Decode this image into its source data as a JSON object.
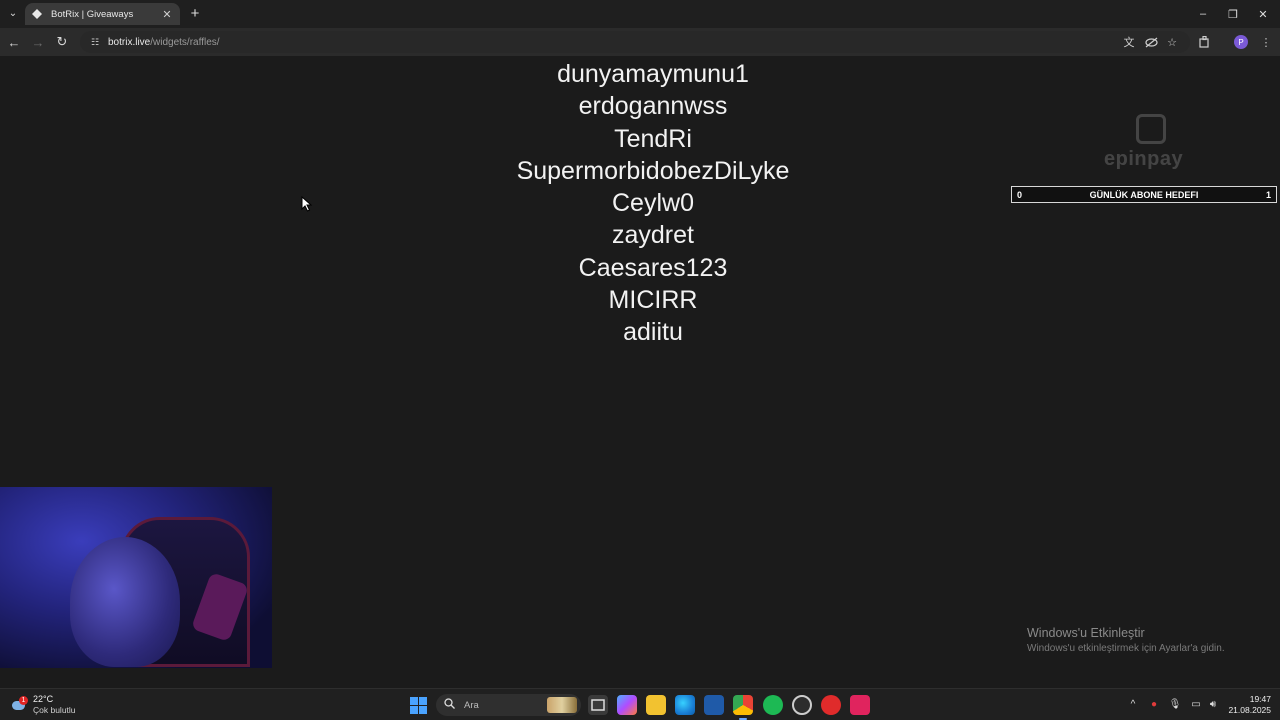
{
  "browser": {
    "tab_title": "BotRix | Giveaways",
    "url_host": "botrix.live",
    "url_path": "/widgets/raffles/",
    "profile_initial": "P"
  },
  "page": {
    "names": [
      "dunyamaymunu1",
      "erdogannwss",
      "TendRi",
      "SupermorbidobezDiLyke",
      "Ceylw0",
      "zaydret",
      "Caesares123",
      "MICIRR",
      "adiitu"
    ],
    "logo_text": "epinpay",
    "goal": {
      "left": "0",
      "label": "GÜNLÜK ABONE HEDEFI",
      "right": "1"
    },
    "activation": {
      "title": "Windows'u Etkinleştir",
      "subtitle": "Windows'u etkinleştirmek için Ayarlar'a gidin."
    }
  },
  "taskbar": {
    "weather_temp": "22°C",
    "weather_condition": "Çok bulutlu",
    "weather_badge": "1",
    "search_placeholder": "Ara",
    "time": "19:47",
    "date": "21.08.2025"
  },
  "colors": {
    "background": "#1b1b1b",
    "tab_active": "#3a3a3a",
    "toolbar": "#2b2b2b",
    "taskbar": "#202020",
    "windows_blue": "#4aa3ff",
    "goal_border": "#d8d8d8"
  }
}
